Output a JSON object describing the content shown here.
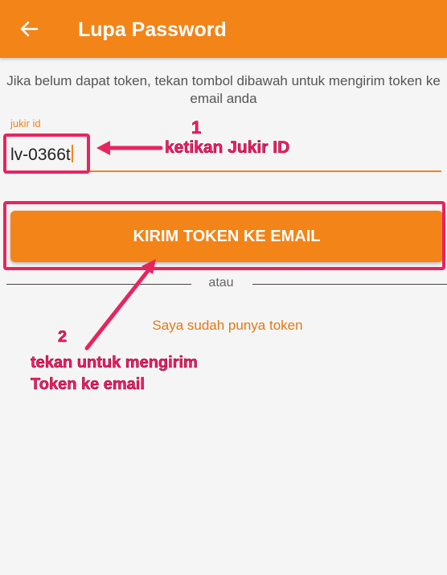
{
  "app_bar": {
    "title": "Lupa Password",
    "back_icon": "arrow-left-icon",
    "color": "#f28418"
  },
  "form": {
    "instruction": "Jika belum dapat token, tekan tombol dibawah untuk mengirim token ke email anda",
    "jukir_id_label": "jukir id",
    "jukir_id_value": "lv-0366t",
    "send_button_label": "KIRIM TOKEN KE EMAIL",
    "divider_text": "atau",
    "have_token_link": "Saya sudah punya token"
  },
  "annotations": {
    "step1_number": "1",
    "step1_text": "ketikan Jukir ID",
    "step2_number": "2",
    "step2_line1": "tekan untuk mengirim",
    "step2_line2": "Token ke email",
    "color": "#e8245e"
  }
}
